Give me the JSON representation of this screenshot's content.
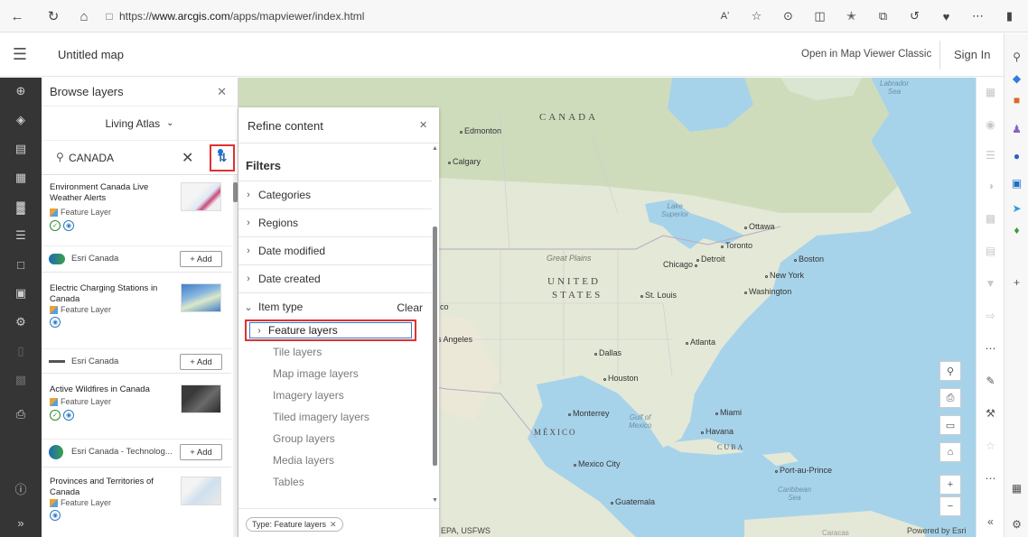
{
  "browser": {
    "url_prefix": "https://",
    "url_domain": "www.arcgis.com",
    "url_path": "/apps/mapviewer/index.html",
    "read_aloud_label": "Aʹ",
    "icons": [
      "back-icon",
      "refresh-icon",
      "home-icon",
      "lock-icon",
      "read-aloud-icon",
      "favorite-icon",
      "extension-icon",
      "split-screen-icon",
      "favorites-bar-icon",
      "collections-icon",
      "history-icon",
      "performance-icon",
      "more-icon",
      "sidebar-toggle-icon"
    ]
  },
  "header": {
    "title": "Untitled map",
    "open_classic": "Open in Map Viewer Classic",
    "sign_in": "Sign In"
  },
  "browse": {
    "title": "Browse layers",
    "source": "Living Atlas",
    "search_value": "CANADA",
    "results": [
      {
        "title": "Environment Canada Live Weather Alerts",
        "type": "Feature Layer",
        "badges": [
          "authoritative",
          "living-atlas"
        ],
        "owner": "Esri Canada",
        "add": "+ Add"
      },
      {
        "title": "Electric Charging Stations in Canada",
        "type": "Feature Layer",
        "badges": [
          "living-atlas"
        ],
        "owner": "Esri Canada",
        "add": "+ Add"
      },
      {
        "title": "Active Wildfires in Canada",
        "type": "Feature Layer",
        "badges": [
          "authoritative",
          "living-atlas"
        ],
        "owner": "Esri Canada - Technolog...",
        "add": "+ Add"
      },
      {
        "title": "Provinces and Territories of Canada",
        "type": "Feature Layer",
        "badges": [
          "living-atlas"
        ],
        "owner": "",
        "add": ""
      }
    ]
  },
  "refine": {
    "title": "Refine content",
    "filters_title": "Filters",
    "rows": [
      "Categories",
      "Regions",
      "Date modified",
      "Date created"
    ],
    "item_type": "Item type",
    "clear": "Clear",
    "feature_layers": "Feature layers",
    "sub_items": [
      "Tile layers",
      "Map image layers",
      "Imagery layers",
      "Tiled imagery layers",
      "Group layers",
      "Media layers",
      "Tables"
    ],
    "chip": "Type: Feature layers"
  },
  "map": {
    "labels": {
      "canada": "CANADA",
      "us1": "UNITED",
      "us2": "STATES",
      "mexico": "MÉXICO",
      "cuba": "CUBA",
      "labrador1": "Labrador",
      "labrador2": "Sea",
      "lake1": "Lake",
      "lake2": "Superior",
      "gulf1": "Gulf of",
      "gulf2": "Mexico",
      "carib1": "Caribbean",
      "carib2": "Sea",
      "great_plains": "Great Plains",
      "edmonton": "Edmonton",
      "calgary": "Calgary",
      "ottawa": "Ottawa",
      "toronto": "Toronto",
      "boston": "Boston",
      "detroit": "Detroit",
      "chicago": "Chicago",
      "new_york": "New York",
      "washington": "Washington",
      "st_louis": "St. Louis",
      "atlanta": "Atlanta",
      "dallas": "Dallas",
      "houston": "Houston",
      "los_angeles": "s Angeles",
      "monterrey": "Monterrey",
      "miami": "Miami",
      "havana": "Havana",
      "mexico_city": "Mexico City",
      "guatemala": "Guatemala",
      "port_au_prince": "Port-au-Prince",
      "caracas": "Caracas",
      "co": "co"
    },
    "attribution_left": "EPA, USFWS",
    "powered_by": "Powered by Esri"
  }
}
